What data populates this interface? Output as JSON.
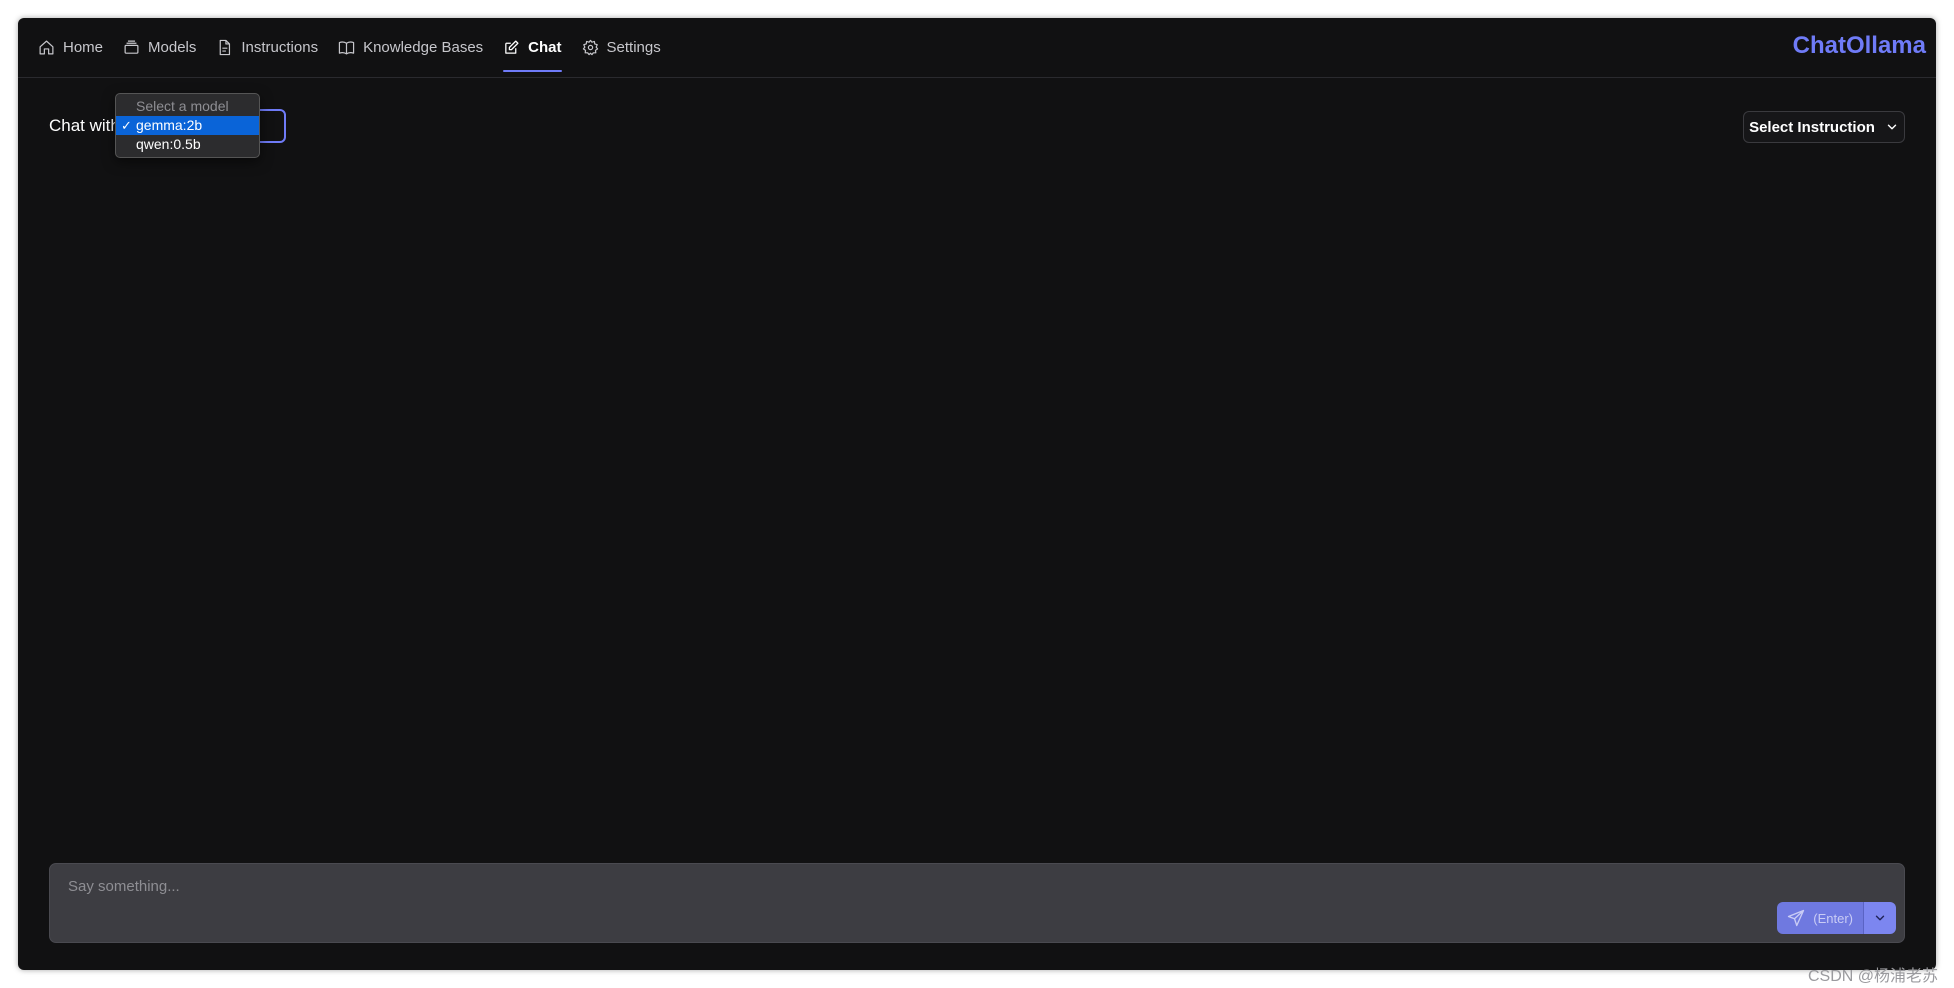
{
  "app": {
    "brand": "ChatOllama",
    "accent_color": "#6f7bf7"
  },
  "nav": {
    "items": [
      {
        "label": "Home",
        "icon": "home-icon"
      },
      {
        "label": "Models",
        "icon": "models-icon"
      },
      {
        "label": "Instructions",
        "icon": "document-icon"
      },
      {
        "label": "Knowledge Bases",
        "icon": "book-icon"
      },
      {
        "label": "Chat",
        "icon": "edit-icon",
        "active": true
      },
      {
        "label": "Settings",
        "icon": "gear-icon"
      }
    ]
  },
  "chat": {
    "chat_with_label": "Chat with",
    "model_select": {
      "placeholder": "Select a model",
      "check_mark": "✓",
      "options": [
        "gemma:2b",
        "qwen:0.5b"
      ],
      "selected": "gemma:2b"
    },
    "instruction_button": "Select Instruction",
    "input_placeholder": "Say something...",
    "send_hint": "(Enter)"
  },
  "watermark": "CSDN @杨浦老苏"
}
